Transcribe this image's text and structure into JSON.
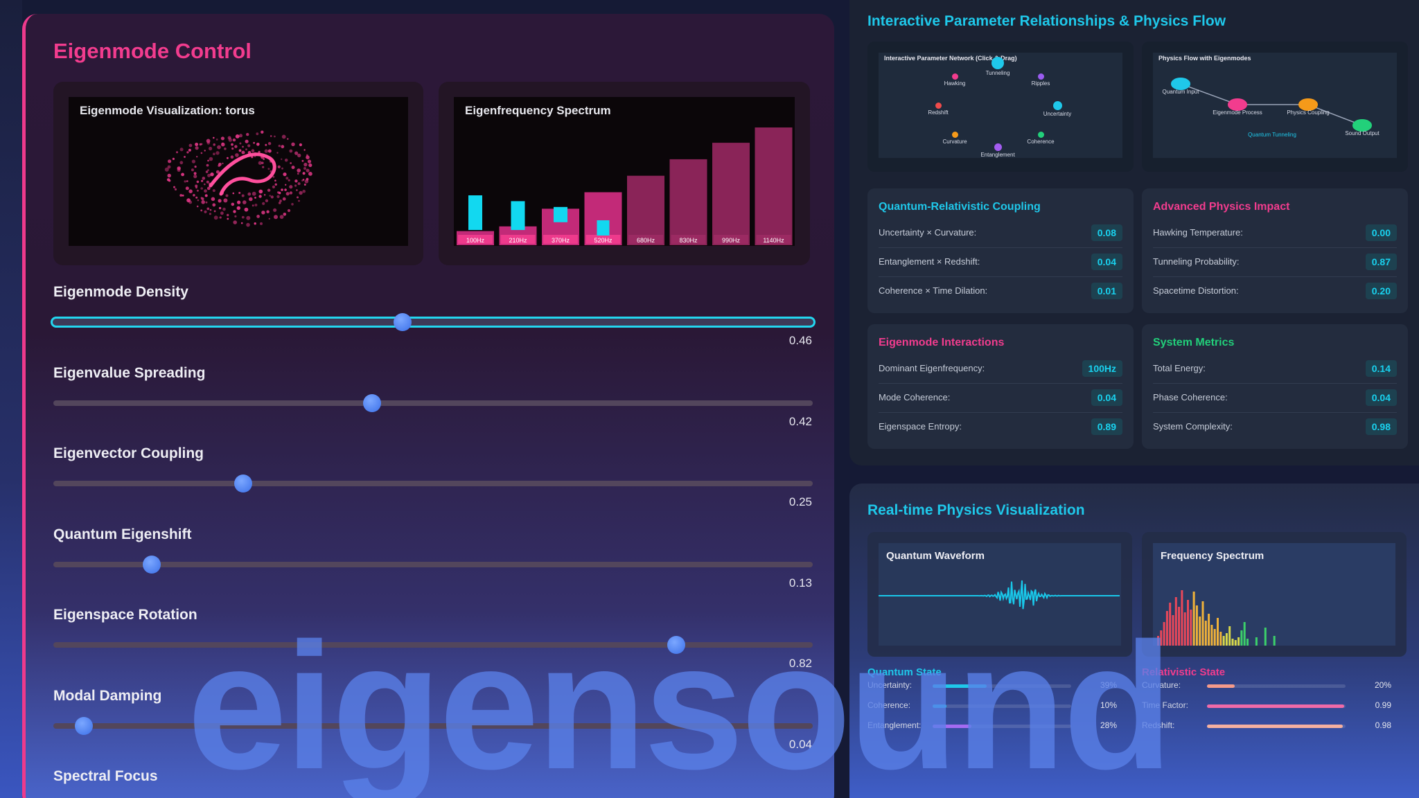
{
  "left": {
    "title": "Eigenmode Control",
    "viz_title": "Eigenmode Visualization: torus",
    "spectrum_title": "Eigenfrequency Spectrum",
    "spectrum_labels": [
      "100Hz",
      "210Hz",
      "370Hz",
      "520Hz",
      "680Hz",
      "830Hz",
      "990Hz",
      "1140Hz"
    ],
    "spectrum_bar_levels": [
      0.12,
      0.16,
      0.31,
      0.45,
      0.59,
      0.73,
      0.87,
      1.0
    ],
    "spectrum_marker_levels": [
      0.45,
      0.38,
      0.31,
      0.15,
      null,
      null,
      null,
      null
    ],
    "sliders": [
      {
        "label": "Eigenmode Density",
        "value": "0.46",
        "fraction": 0.46,
        "active": true
      },
      {
        "label": "Eigenvalue Spreading",
        "value": "0.42",
        "fraction": 0.42
      },
      {
        "label": "Eigenvector Coupling",
        "value": "0.25",
        "fraction": 0.25
      },
      {
        "label": "Quantum Eigenshift",
        "value": "0.13",
        "fraction": 0.13
      },
      {
        "label": "Eigenspace Rotation",
        "value": "0.82",
        "fraction": 0.82
      },
      {
        "label": "Modal Damping",
        "value": "0.04",
        "fraction": 0.04
      },
      {
        "label": "Spectral Focus"
      }
    ]
  },
  "watermark": "eigensound",
  "right_top": {
    "title": "Interactive Parameter Relationships & Physics Flow",
    "network_title": "Interactive Parameter Network (Click & Drag)",
    "network_nodes": [
      "Tunneling",
      "Hawking",
      "Ripples",
      "Redshift",
      "Uncertainty",
      "Curvature",
      "Coherence",
      "Entanglement"
    ],
    "flow_title": "Physics Flow with Eigenmodes",
    "flow_nodes": [
      "Quantum Input",
      "Eigenmode Process",
      "Physics Coupling",
      "Sound Output"
    ],
    "flow_caption": "Quantum Tunneling",
    "cards": [
      {
        "title": "Quantum-Relativistic Coupling",
        "color": "#1fc8ea",
        "rows": [
          {
            "label": "Uncertainty × Curvature:",
            "value": "0.08"
          },
          {
            "label": "Entanglement × Redshift:",
            "value": "0.04"
          },
          {
            "label": "Coherence × Time Dilation:",
            "value": "0.01"
          }
        ]
      },
      {
        "title": "Advanced Physics Impact",
        "color": "#f23c8e",
        "rows": [
          {
            "label": "Hawking Temperature:",
            "value": "0.00"
          },
          {
            "label": "Tunneling Probability:",
            "value": "0.87"
          },
          {
            "label": "Spacetime Distortion:",
            "value": "0.20"
          }
        ]
      },
      {
        "title": "Eigenmode Interactions",
        "color": "#f23c8e",
        "rows": [
          {
            "label": "Dominant Eigenfrequency:",
            "value": "100Hz"
          },
          {
            "label": "Mode Coherence:",
            "value": "0.04"
          },
          {
            "label": "Eigenspace Entropy:",
            "value": "0.89"
          }
        ]
      },
      {
        "title": "System Metrics",
        "color": "#22d07a",
        "rows": [
          {
            "label": "Total Energy:",
            "value": "0.14"
          },
          {
            "label": "Phase Coherence:",
            "value": "0.04"
          },
          {
            "label": "System Complexity:",
            "value": "0.98"
          }
        ]
      }
    ]
  },
  "right_bottom": {
    "title": "Real-time Physics Visualization",
    "waveform_title": "Quantum Waveform",
    "spectrum_title": "Frequency Spectrum",
    "quantum_state": {
      "title": "Quantum State",
      "rows": [
        {
          "label": "Uncertainty:",
          "value": "39%",
          "fraction": 0.39,
          "color": "#1fc8ea"
        },
        {
          "label": "Coherence:",
          "value": "10%",
          "fraction": 0.1,
          "color": "#1fc8ea"
        },
        {
          "label": "Entanglement:",
          "value": "28%",
          "fraction": 0.28,
          "color": "#a46bf2"
        }
      ]
    },
    "relativistic_state": {
      "title": "Relativistic State",
      "rows": [
        {
          "label": "Curvature:",
          "value": "20%",
          "fraction": 0.2,
          "color": "#f59a8a"
        },
        {
          "label": "Time Factor:",
          "value": "0.99",
          "fraction": 0.99,
          "color": "#f06aa8"
        },
        {
          "label": "Redshift:",
          "value": "0.98",
          "fraction": 0.98,
          "color": "#f5b0a0"
        }
      ]
    }
  }
}
